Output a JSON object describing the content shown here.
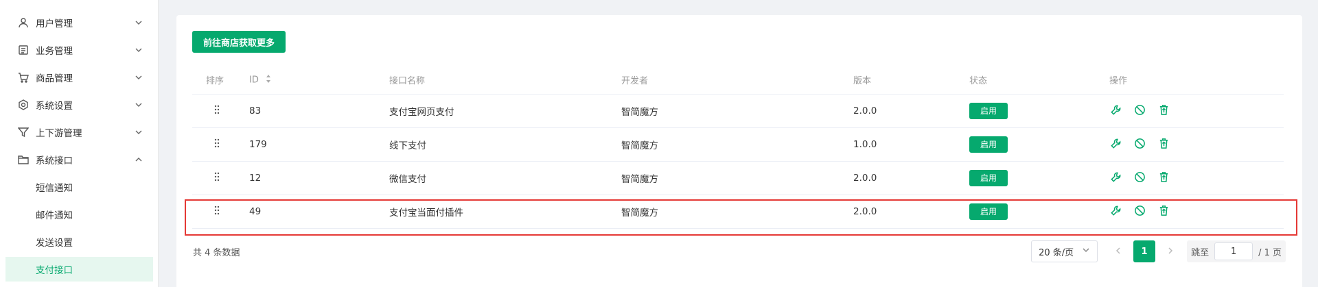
{
  "sidebar": {
    "items": [
      {
        "label": "用户管理",
        "icon": "user-icon",
        "expanded": false
      },
      {
        "label": "业务管理",
        "icon": "document-icon",
        "expanded": false
      },
      {
        "label": "商品管理",
        "icon": "cart-icon",
        "expanded": false
      },
      {
        "label": "系统设置",
        "icon": "settings-icon",
        "expanded": false
      },
      {
        "label": "上下游管理",
        "icon": "filter-icon",
        "expanded": false
      },
      {
        "label": "系统接口",
        "icon": "folder-icon",
        "expanded": true
      }
    ],
    "subitems": [
      {
        "label": "短信通知",
        "active": false
      },
      {
        "label": "邮件通知",
        "active": false
      },
      {
        "label": "发送设置",
        "active": false
      },
      {
        "label": "支付接口",
        "active": true
      }
    ]
  },
  "toolbar": {
    "store_button_label": "前往商店获取更多"
  },
  "table": {
    "headers": {
      "sort": "排序",
      "id": "ID",
      "name": "接口名称",
      "developer": "开发者",
      "version": "版本",
      "status": "状态",
      "actions": "操作"
    },
    "rows": [
      {
        "id": "83",
        "name": "支付宝网页支付",
        "developer": "智简魔方",
        "version": "2.0.0",
        "status": "启用"
      },
      {
        "id": "179",
        "name": "线下支付",
        "developer": "智简魔方",
        "version": "1.0.0",
        "status": "启用"
      },
      {
        "id": "12",
        "name": "微信支付",
        "developer": "智简魔方",
        "version": "2.0.0",
        "status": "启用"
      },
      {
        "id": "49",
        "name": "支付宝当面付插件",
        "developer": "智简魔方",
        "version": "2.0.0",
        "status": "启用"
      }
    ]
  },
  "footer": {
    "total_text": "共 4 条数据",
    "page_size": "20 条/页",
    "current_page": "1",
    "jump_label": "跳至",
    "jump_value": "1",
    "total_pages": "/ 1 页"
  },
  "colors": {
    "accent": "#06a96e",
    "highlight": "#e53935"
  }
}
